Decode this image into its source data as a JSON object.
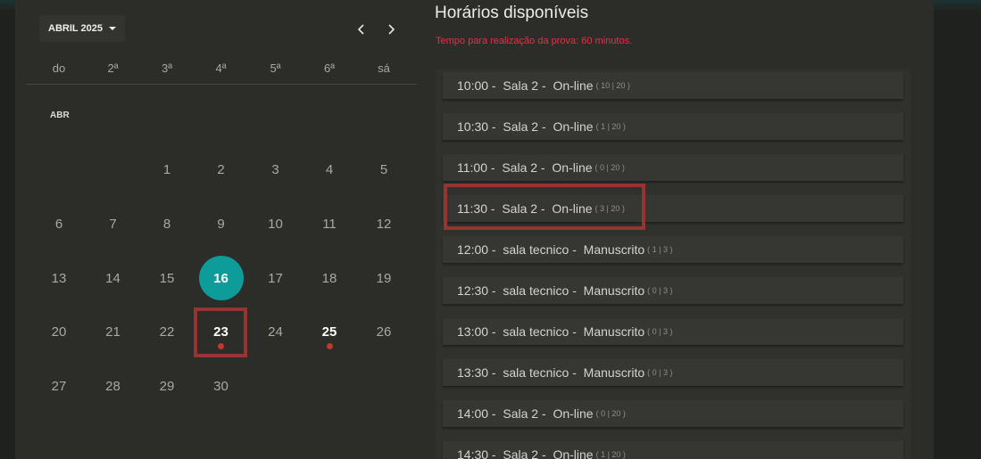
{
  "calendar": {
    "month_button": "ABRIL 2025",
    "prev_icon": "chevron-left-icon",
    "next_icon": "chevron-right-icon",
    "weekdays": [
      "do",
      "2ª",
      "3ª",
      "4ª",
      "5ª",
      "6ª",
      "sá"
    ],
    "month_label": "ABR",
    "days": [
      "1",
      "2",
      "3",
      "4",
      "5",
      "6",
      "7",
      "8",
      "9",
      "10",
      "11",
      "12",
      "13",
      "14",
      "15",
      "16",
      "17",
      "18",
      "19",
      "20",
      "21",
      "22",
      "23",
      "24",
      "25",
      "26",
      "27",
      "28",
      "29",
      "30"
    ],
    "selected_day": "16",
    "highlighted_day": "23",
    "days_with_availability": [
      "23",
      "25"
    ],
    "accent_color": "#0e9c9a",
    "marker_color": "#c0392f"
  },
  "times": {
    "title": "Horários disponíveis",
    "note": "Tempo para realização da prova: 60 minutos.",
    "slots": [
      {
        "time": "10:00",
        "room": "Sala 2",
        "mode": "On-line",
        "capacity": "( 10 | 20 )"
      },
      {
        "time": "10:30",
        "room": "Sala 2",
        "mode": "On-line",
        "capacity": "( 1 | 20 )"
      },
      {
        "time": "11:00",
        "room": "Sala 2",
        "mode": "On-line",
        "capacity": "( 0 | 20 )"
      },
      {
        "time": "11:30",
        "room": "Sala 2",
        "mode": "On-line",
        "capacity": "( 3 | 20 )"
      },
      {
        "time": "12:00",
        "room": "sala tecnico",
        "mode": "Manuscrito",
        "capacity": "( 1 | 3 )"
      },
      {
        "time": "12:30",
        "room": "sala tecnico",
        "mode": "Manuscrito",
        "capacity": "( 0 | 3 )"
      },
      {
        "time": "13:00",
        "room": "sala tecnico",
        "mode": "Manuscrito",
        "capacity": "( 0 | 3 )"
      },
      {
        "time": "13:30",
        "room": "sala tecnico",
        "mode": "Manuscrito",
        "capacity": "( 0 | 3 )"
      },
      {
        "time": "14:00",
        "room": "Sala 2",
        "mode": "On-line",
        "capacity": "( 0 | 20 )"
      },
      {
        "time": "14:30",
        "room": "Sala 2",
        "mode": "On-line",
        "capacity": "( 1 | 20 )"
      }
    ],
    "highlighted_slot": "11:30",
    "note_color": "#e0334a"
  }
}
